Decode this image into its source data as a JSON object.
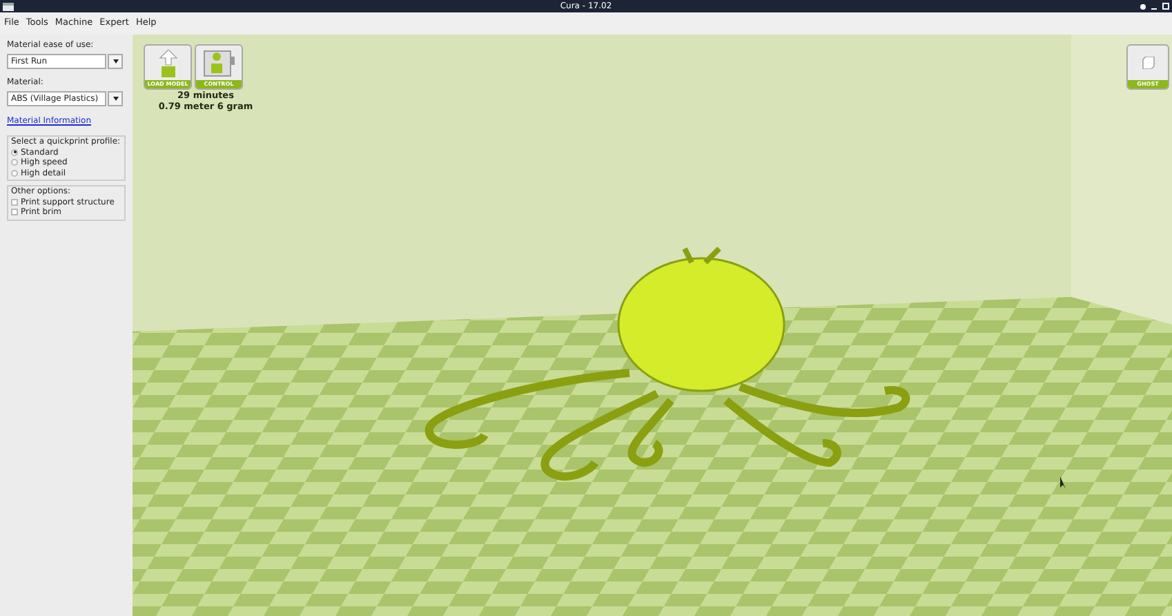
{
  "window": {
    "title": "Cura - 17.02"
  },
  "menu": [
    "File",
    "Tools",
    "Machine",
    "Expert",
    "Help"
  ],
  "sidebar": {
    "ease_label": "Material ease of use:",
    "ease_value": "First Run",
    "material_label": "Material:",
    "material_value": "ABS (Village Plastics)",
    "material_link": "Material Information",
    "profile_group": {
      "title": "Select a quickprint profile:",
      "options": [
        {
          "label": "Standard",
          "selected": true
        },
        {
          "label": "High speed",
          "selected": false
        },
        {
          "label": "High detail",
          "selected": false
        }
      ]
    },
    "options_group": {
      "title": "Other options:",
      "options": [
        {
          "label": "Print support structure",
          "checked": false
        },
        {
          "label": "Print brim",
          "checked": false
        }
      ]
    }
  },
  "toolbar": [
    {
      "kind": "load",
      "label": "LOAD MODEL"
    },
    {
      "kind": "control",
      "label": "CONTROL"
    }
  ],
  "estimate": [
    "29 minutes",
    "0.79 meter 6 gram"
  ],
  "view_button": {
    "label": "GHOST"
  }
}
